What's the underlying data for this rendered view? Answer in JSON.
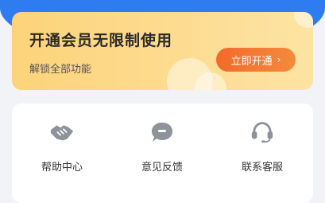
{
  "vip": {
    "title": "开通会员无限制使用",
    "subtitle": "解锁全部功能",
    "button_label": "立即开通",
    "button_arrow": "›"
  },
  "tools": [
    {
      "label": "帮助中心",
      "icon": "handshake-icon"
    },
    {
      "label": "意见反馈",
      "icon": "chat-bubble-icon"
    },
    {
      "label": "联系客服",
      "icon": "headset-icon"
    }
  ],
  "colors": {
    "header_blue": "#2f7bf0",
    "vip_gold": "#fdd37a",
    "button_orange": "#f36a2c",
    "icon_gray": "#8e939b"
  }
}
